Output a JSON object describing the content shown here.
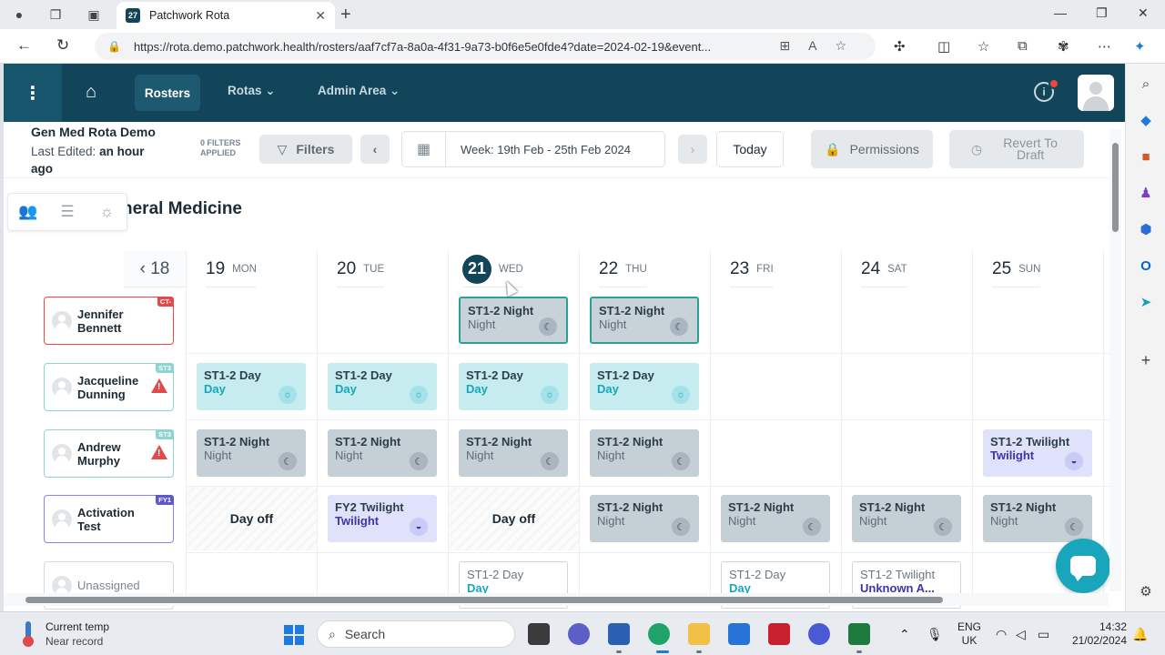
{
  "browser": {
    "tab_title": "Patchwork Rota",
    "tab_favicon": "27",
    "url": "https://rota.demo.patchwork.health/rosters/aaf7cf7a-8a0a-4f31-9a73-b0f6e5e0fde4?date=2024-02-19&event..."
  },
  "header": {
    "nav_rosters": "Rosters",
    "nav_rotas": "Rotas",
    "nav_admin": "Admin Area",
    "brand_color": "#12455a"
  },
  "toolbar": {
    "rota_name": "Gen Med Rota Demo",
    "last_edited_label": "Last Edited:",
    "last_edited_value": "an hour ago",
    "filters_count": "0 FILTERS APPLIED",
    "filters_label": "Filters",
    "week_label": "Week: 19th Feb - 25th Feb 2024",
    "today_label": "Today",
    "permissions_label": "Permissions",
    "revert_label": "Revert To Draft"
  },
  "department": "neral Medicine",
  "calendar": {
    "prev_day": "18",
    "days": [
      {
        "num": "19",
        "name": "MON",
        "today": false
      },
      {
        "num": "20",
        "name": "TUE",
        "today": false
      },
      {
        "num": "21",
        "name": "WED",
        "today": true
      },
      {
        "num": "22",
        "name": "THU",
        "today": false
      },
      {
        "num": "23",
        "name": "FRI",
        "today": false
      },
      {
        "num": "24",
        "name": "SAT",
        "today": false
      },
      {
        "num": "25",
        "name": "SUN",
        "today": false
      }
    ],
    "people": [
      {
        "first": "Jennifer",
        "last": "Bennett",
        "badge": "CT-",
        "badge_color": "#e04a4a",
        "warning": false
      },
      {
        "first": "Jacqueline",
        "last": "Dunning",
        "badge": "ST3",
        "badge_color": "#8fd5cf",
        "warning": true
      },
      {
        "first": "Andrew",
        "last": "Murphy",
        "badge": "ST3",
        "badge_color": "#8fd5cf",
        "warning": true
      },
      {
        "first": "Activation",
        "last": "Test",
        "badge": "FY1",
        "badge_color": "#5f58cc",
        "warning": false
      },
      {
        "first": "Unassigned",
        "last": "",
        "badge": "",
        "badge_color": "",
        "warning": false
      }
    ],
    "day_off_label": "Day off",
    "shifts": {
      "s_jb_wed": {
        "title": "ST1-2 Night",
        "type": "Night"
      },
      "s_jb_thu": {
        "title": "ST1-2 Night",
        "type": "Night"
      },
      "s_jd_mon": {
        "title": "ST1-2 Day",
        "type": "Day"
      },
      "s_jd_tue": {
        "title": "ST1-2 Day",
        "type": "Day"
      },
      "s_jd_wed": {
        "title": "ST1-2 Day",
        "type": "Day"
      },
      "s_jd_thu": {
        "title": "ST1-2 Day",
        "type": "Day"
      },
      "s_am_mon": {
        "title": "ST1-2 Night",
        "type": "Night"
      },
      "s_am_tue": {
        "title": "ST1-2 Night",
        "type": "Night"
      },
      "s_am_wed": {
        "title": "ST1-2 Night",
        "type": "Night"
      },
      "s_am_thu": {
        "title": "ST1-2 Night",
        "type": "Night"
      },
      "s_am_sun": {
        "title": "ST1-2 Twilight",
        "type": "Twilight"
      },
      "s_at_tue": {
        "title": "FY2 Twilight",
        "type": "Twilight"
      },
      "s_at_thu": {
        "title": "ST1-2 Night",
        "type": "Night"
      },
      "s_at_fri": {
        "title": "ST1-2 Night",
        "type": "Night"
      },
      "s_at_sat": {
        "title": "ST1-2 Night",
        "type": "Night"
      },
      "s_at_sun": {
        "title": "ST1-2 Night",
        "type": "Night"
      },
      "s_un_wed": {
        "title": "ST1-2 Day",
        "type": "Day"
      },
      "s_un_fri": {
        "title": "ST1-2 Day",
        "type": "Day"
      },
      "s_un_sat": {
        "title": "ST1-2 Twilight",
        "type": "Unknown A..."
      }
    }
  },
  "taskbar": {
    "weather_line1": "Current temp",
    "weather_line2": "Near record",
    "search_placeholder": "Search",
    "lang_line1": "ENG",
    "lang_line2": "UK",
    "time": "14:32",
    "date": "21/02/2024"
  }
}
